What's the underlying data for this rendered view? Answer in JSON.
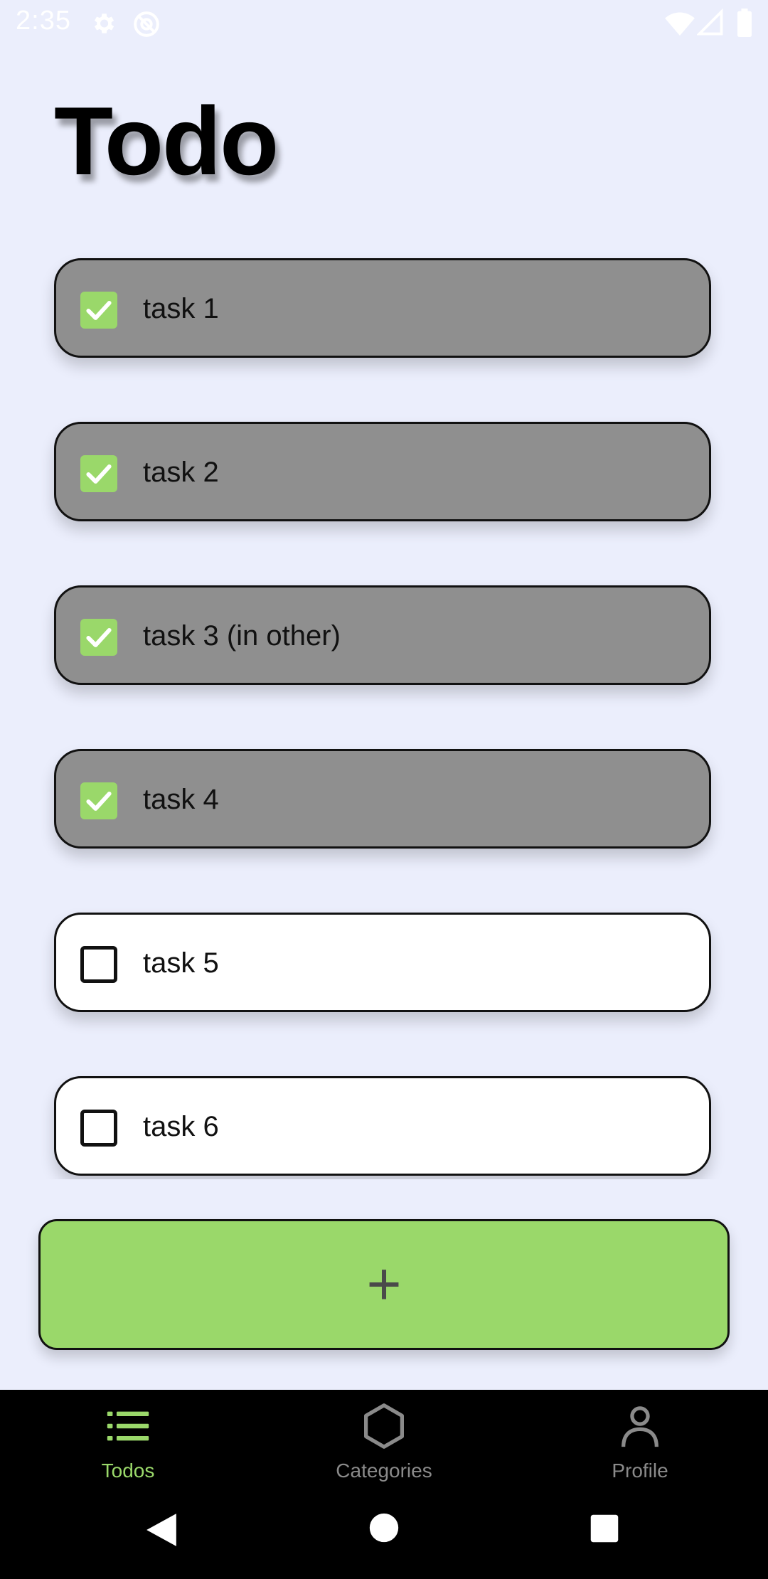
{
  "status_bar": {
    "time": "2:35",
    "left_icons": [
      "gear-icon",
      "at-sign-icon"
    ],
    "right_icons": [
      "wifi-icon",
      "signal-icon",
      "battery-icon"
    ]
  },
  "page": {
    "title": "Todo"
  },
  "todos": [
    {
      "label": "task 1",
      "done": true
    },
    {
      "label": "task 2",
      "done": true
    },
    {
      "label": "task 3 (in other)",
      "done": true
    },
    {
      "label": "task 4",
      "done": true
    },
    {
      "label": "task 5",
      "done": false
    },
    {
      "label": "task 6",
      "done": false
    }
  ],
  "add_button": {
    "label": "+"
  },
  "bottom_nav": {
    "items": [
      {
        "label": "Todos",
        "icon": "list-icon",
        "active": true
      },
      {
        "label": "Categories",
        "icon": "hexagon-icon",
        "active": false
      },
      {
        "label": "Profile",
        "icon": "person-icon",
        "active": false
      }
    ]
  },
  "system_nav": [
    "back-icon",
    "home-icon",
    "recents-icon"
  ],
  "colors": {
    "background": "#ebeefc",
    "accent_green": "#9ad86a",
    "done_item": "#8f8f8f",
    "nav_inactive": "#8a8a8a"
  }
}
